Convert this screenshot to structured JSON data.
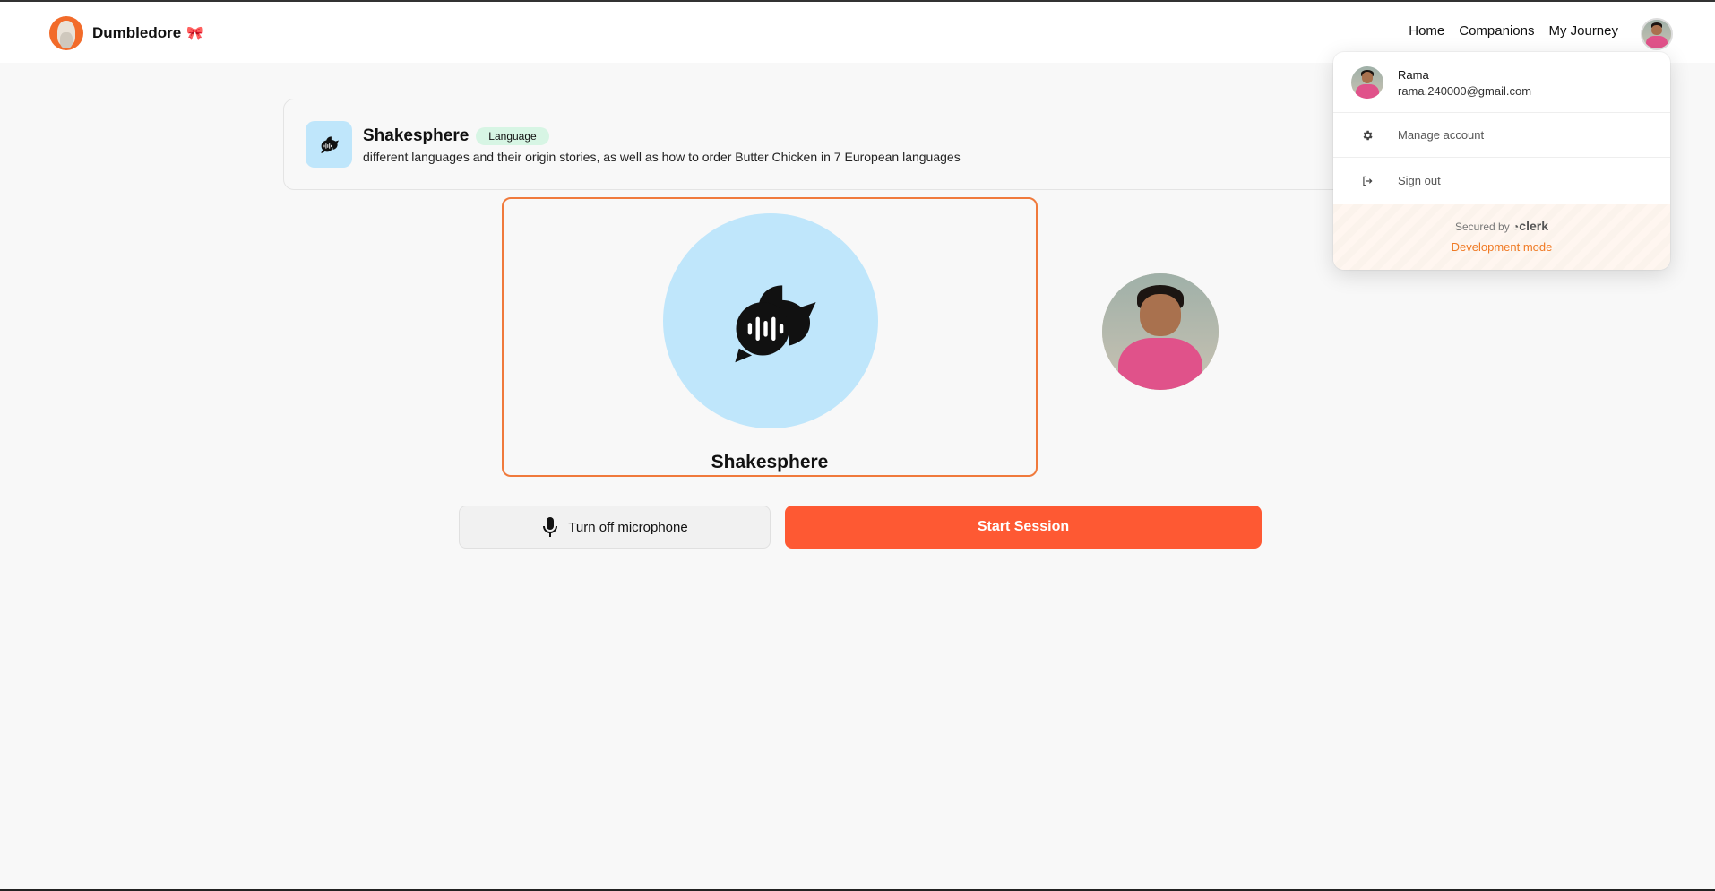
{
  "brand": {
    "name": "Dumbledore",
    "bow_icon": "bow-icon"
  },
  "nav": {
    "links": [
      "Home",
      "Companions",
      "My Journey"
    ]
  },
  "companion": {
    "name": "Shakesphere",
    "subject": "Language",
    "topic": "different languages and their origin stories, as well as how to order Butter Chicken in 7 European languages",
    "icon": "speech-bubbles-icon",
    "color": "#bfe6fb"
  },
  "session": {
    "companion_name": "Shakesphere",
    "mic_label": "Turn off microphone",
    "start_label": "Start Session",
    "start_color": "#fe5933",
    "active_border_color": "#f07a3c"
  },
  "user_menu": {
    "name": "Rama",
    "email": "rama.240000@gmail.com",
    "manage_label": "Manage account",
    "signout_label": "Sign out",
    "secured_by": "Secured by",
    "provider": "clerk",
    "dev_mode": "Development mode"
  }
}
